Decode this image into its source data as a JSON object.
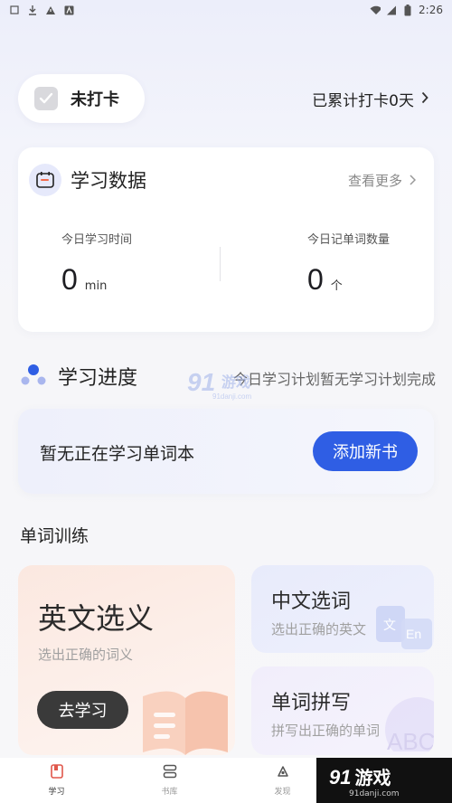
{
  "status_bar": {
    "time": "2:26"
  },
  "checkin": {
    "label": "未打卡",
    "total_text": "已累计打卡0天"
  },
  "study_data": {
    "title": "学习数据",
    "see_more": "查看更多",
    "time_label": "今日学习时间",
    "time_value": "0",
    "time_unit": "min",
    "words_label": "今日记单词数量",
    "words_value": "0",
    "words_unit": "个"
  },
  "progress": {
    "title": "学习进度",
    "plan_note": "今日学习计划暂无学习计划完成",
    "empty_text": "暂无正在学习单词本",
    "add_button": "添加新书"
  },
  "training": {
    "section_title": "单词训练",
    "cards": [
      {
        "title": "英文选义",
        "subtitle": "选出正确的词义",
        "button": "去学习"
      },
      {
        "title": "中文选词",
        "subtitle": "选出正确的英文"
      },
      {
        "title": "单词拼写",
        "subtitle": "拼写出正确的单词"
      }
    ]
  },
  "tabbar": {
    "tabs": [
      {
        "label": "学习",
        "icon": "book-icon"
      },
      {
        "label": "书库",
        "icon": "library-icon"
      },
      {
        "label": "发现",
        "icon": "discover-icon"
      }
    ]
  },
  "watermark": {
    "logo": "91",
    "text": "游戏",
    "url": "91danji.com"
  },
  "colors": {
    "accent": "#2f5ee4",
    "dark_button": "#3a3a3a"
  }
}
